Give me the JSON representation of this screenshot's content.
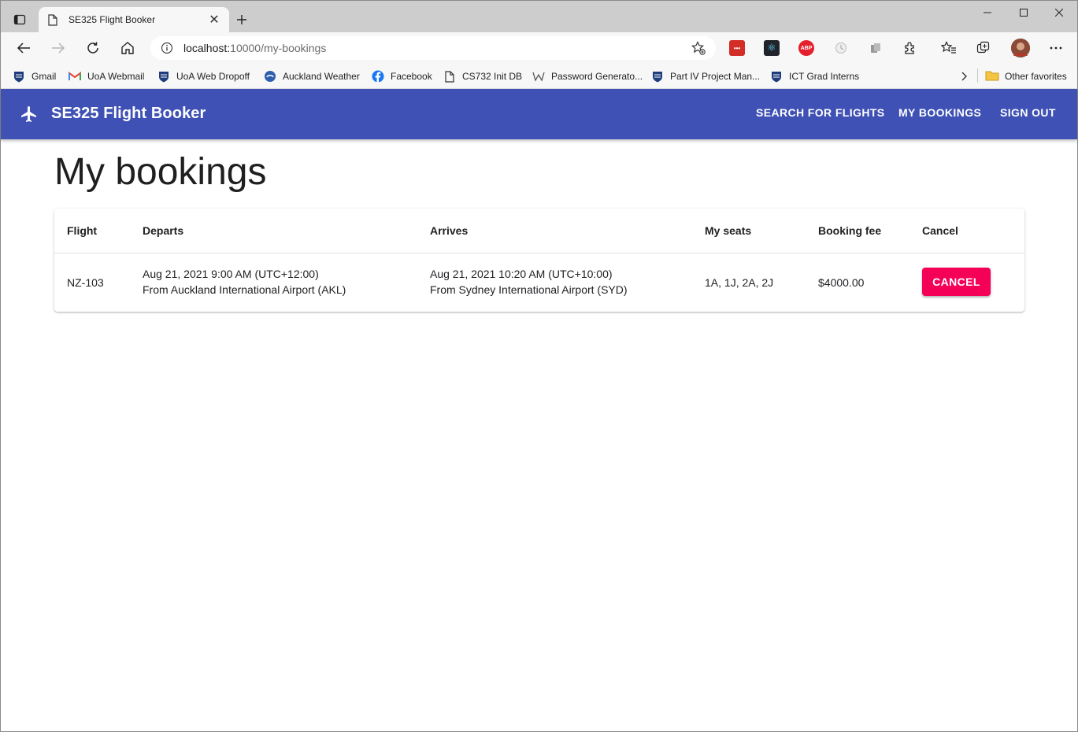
{
  "browser": {
    "tab_title": "SE325 Flight Booker",
    "url_host": "localhost:",
    "url_rest": "10000/my-bookings",
    "bookmarks": [
      {
        "label": "Gmail",
        "icon": "uoa-crest-icon"
      },
      {
        "label": "UoA Webmail",
        "icon": "gmail-icon"
      },
      {
        "label": "UoA Web Dropoff",
        "icon": "uoa-crest-icon"
      },
      {
        "label": "Auckland Weather",
        "icon": "weather-icon"
      },
      {
        "label": "Facebook",
        "icon": "facebook-icon"
      },
      {
        "label": "CS732 Init DB",
        "icon": "page-icon"
      },
      {
        "label": "Password Generato...",
        "icon": "password-icon"
      },
      {
        "label": "Part IV Project Man...",
        "icon": "uoa-crest-icon"
      },
      {
        "label": "ICT Grad Interns",
        "icon": "uoa-crest-icon"
      }
    ],
    "other_favorites": "Other favorites",
    "extensions": [
      {
        "name": "lastpass-icon",
        "text": "•••",
        "color": "#d32d27"
      },
      {
        "name": "react-devtools-icon",
        "text": "⚛",
        "color": "#20232a"
      },
      {
        "name": "adblock-icon",
        "text": "ABP",
        "color": "#e51f2b"
      }
    ]
  },
  "app": {
    "title": "SE325 Flight Booker",
    "nav": {
      "search": "SEARCH FOR FLIGHTS",
      "bookings": "MY BOOKINGS",
      "signout": "SIGN OUT"
    },
    "colors": {
      "appbar": "#3f51b5",
      "accent": "#f50057"
    }
  },
  "page": {
    "title": "My bookings"
  },
  "bookings_table": {
    "headers": {
      "flight": "Flight",
      "departs": "Departs",
      "arrives": "Arrives",
      "seats": "My seats",
      "fee": "Booking fee",
      "cancel": "Cancel"
    },
    "rows": [
      {
        "flight": "NZ-103",
        "departs_time": "Aug 21, 2021 9:00 AM (UTC+12:00)",
        "departs_from": "From Auckland International Airport (AKL)",
        "arrives_time": "Aug 21, 2021 10:20 AM (UTC+10:00)",
        "arrives_from": "From Sydney International Airport (SYD)",
        "seats": "1A, 1J, 2A, 2J",
        "fee": "$4000.00",
        "cancel_label": "CANCEL"
      }
    ]
  }
}
